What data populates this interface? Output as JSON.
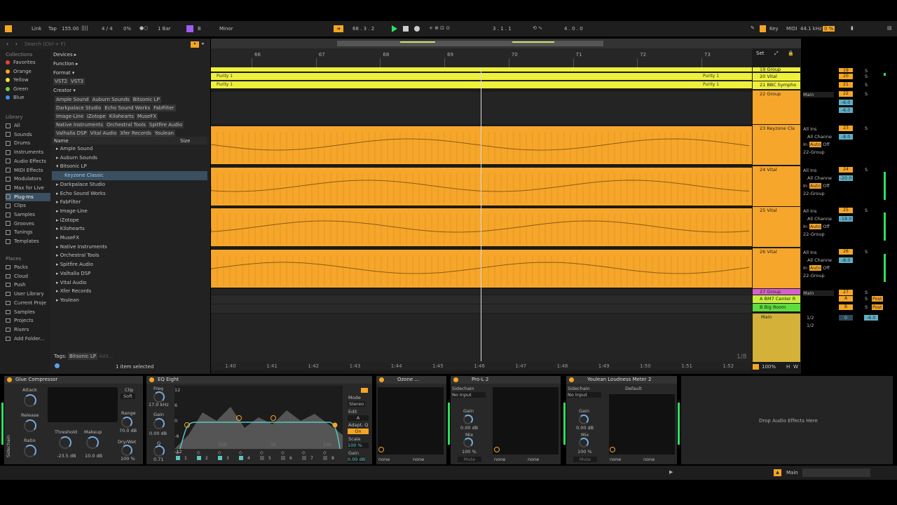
{
  "transport": {
    "link": "Link",
    "tap": "Tap",
    "tempo": "155.00",
    "signature": "4 / 4",
    "swing": "0%",
    "quantize": "1 Bar",
    "scale_root": "B",
    "scale_mode": "Minor",
    "position": "68 .  3 .  2",
    "loop_start": "3 .  1 .  1",
    "loop_length": "4 .  0 .  0",
    "key": "Key",
    "midi": "MIDI",
    "sample_rate": "44.1 kHz",
    "cpu": "0 %"
  },
  "browser": {
    "search_placeholder": "Search (Ctrl + F)",
    "collections_title": "Collections",
    "collections": [
      {
        "label": "Favorites",
        "color": "#e8433c"
      },
      {
        "label": "Orange",
        "color": "#f5a623"
      },
      {
        "label": "Yellow",
        "color": "#f0e040"
      },
      {
        "label": "Green",
        "color": "#6bd34a"
      },
      {
        "label": "Blue",
        "color": "#3d8ef0"
      }
    ],
    "library_title": "Library",
    "library": [
      "All",
      "Sounds",
      "Drums",
      "Instruments",
      "Audio Effects",
      "MIDI Effects",
      "Modulators",
      "Max for Live",
      "Plug-Ins",
      "Clips",
      "Samples",
      "Grooves",
      "Tunings",
      "Templates"
    ],
    "places_title": "Places",
    "places": [
      "Packs",
      "Cloud",
      "Push",
      "User Library",
      "Current Proje",
      "Samples",
      "Projects",
      "Risers",
      "Add Folder..."
    ],
    "filters": {
      "devices": "Devices ▸",
      "function": "Function ▸",
      "format": "Format ▾",
      "creator": "Creator ▾"
    },
    "format_tags": [
      "VST2",
      "VST3"
    ],
    "creator_tags": [
      "Ample Sound",
      "Auburn Sounds",
      "Bitsonic LP",
      "Darkpalace Studio",
      "Echo Sound Works",
      "FabFilter",
      "Image-Line",
      "iZotope",
      "Kilohearts",
      "MuseFX",
      "Native Instruments",
      "Orchestral Tools",
      "Spitfire Audio",
      "Valhalla DSP",
      "Vital Audio",
      "Xfer Records",
      "Youlean"
    ],
    "col_name": "Name",
    "col_size": "Size",
    "tree": [
      {
        "label": "▸ Ample Sound"
      },
      {
        "label": "▸ Auburn Sounds"
      },
      {
        "label": "▾ Bitsonic LP"
      },
      {
        "label": "Keyzone Classic",
        "selected": true
      },
      {
        "label": "▸ Darkpalace Studio"
      },
      {
        "label": "▸ Echo Sound Works"
      },
      {
        "label": "▸ FabFilter"
      },
      {
        "label": "▸ Image-Line"
      },
      {
        "label": "▸ iZotope"
      },
      {
        "label": "▸ Kilohearts"
      },
      {
        "label": "▸ MuseFX"
      },
      {
        "label": "▸ Native Instruments"
      },
      {
        "label": "▸ Orchestral Tools"
      },
      {
        "label": "▸ Spitfire Audio"
      },
      {
        "label": "▸ Valhalla DSP"
      },
      {
        "label": "▸ Vital Audio"
      },
      {
        "label": "▸ Xfer Records"
      },
      {
        "label": "▸ Youlean"
      }
    ],
    "tags_label": "Tags:",
    "tags_value": "Bitsonic LP",
    "tags_add": "Add...",
    "status": "1 item selected"
  },
  "arrangement": {
    "bars": [
      "66",
      "67",
      "68",
      "69",
      "70",
      "71",
      "72",
      "73"
    ],
    "times": [
      "1:40",
      "1:41",
      "1:42",
      "1:43",
      "1:44",
      "1:45",
      "1:46",
      "1:47",
      "1:48",
      "1:49",
      "1:50",
      "1:51",
      "1:52"
    ],
    "clip_name": "Purity 1",
    "grid": "1/8",
    "set_label": "Set",
    "zoom": "100%"
  },
  "tracks": [
    {
      "name": "19 Group",
      "num": "19"
    },
    {
      "name": "20 Vital",
      "num": "20"
    },
    {
      "name": "21 BBC Sympho",
      "num": "21"
    },
    {
      "name": "22 Group",
      "num": "22",
      "route": "Main",
      "vol": "-6.0",
      "pan": "-6.0"
    },
    {
      "name": "23 Keyzone Cla",
      "num": "23",
      "in": "All Ins",
      "ch": "All Channe",
      "vol": "-8.0",
      "group": "22-Group"
    },
    {
      "name": "24 Vital",
      "num": "24",
      "in": "All Ins",
      "ch": "All Channe",
      "vol": "-20.0",
      "group": "22-Group"
    },
    {
      "name": "25 Vital",
      "num": "25",
      "in": "All Ins",
      "ch": "All Channe",
      "vol": "-18.0",
      "group": "22-Group"
    },
    {
      "name": "26 Vital",
      "num": "26",
      "in": "All Ins",
      "ch": "All Channe",
      "vol": "-8.0",
      "group": "22-Group"
    },
    {
      "name": "27 Group",
      "num": "27",
      "route": "Main"
    }
  ],
  "returns": [
    {
      "name": "A BM7 Center R",
      "letter": "A",
      "post": "Post"
    },
    {
      "name": "B Big Room",
      "letter": "B",
      "post": "Post"
    }
  ],
  "master": {
    "name": "Main",
    "out1": "1/2",
    "out2": "1/2",
    "vol": "0",
    "pan": "-6.0"
  },
  "io": {
    "in": "In",
    "auto": "Auto",
    "off": "Off",
    "inf": "-∞",
    "s": "S",
    "c": "C"
  },
  "devices": {
    "glue": {
      "title": "Glue Compressor",
      "attack": "Attack",
      "release": "Release",
      "ratio": "Ratio",
      "clip": "Clip",
      "clip_val": "Soft",
      "threshold": "Threshold",
      "threshold_val": "-23.5 dB",
      "makeup": "Makeup",
      "makeup_val": "10.0 dB",
      "range": "Range",
      "range_val": "70.0 dB",
      "drywet": "Dry/Wet",
      "drywet_val": "100 %",
      "sidechain": "Sidechain"
    },
    "eq": {
      "title": "EQ Eight",
      "freq": "Freq",
      "freq_val": "17.0 kHz",
      "gain": "Gain",
      "gain_val": "0.00 dB",
      "q": "Q",
      "q_val": "0.71",
      "mode": "Mode",
      "mode_val": "Stereo",
      "edit": "Edit",
      "edit_val": "A",
      "adapt": "Adapt. Q",
      "adapt_val": "On",
      "scale": "Scale",
      "scale_val": "100 %",
      "out_gain": "Gain",
      "out_gain_val": "0.00 dB",
      "db_labels": [
        "12",
        "6",
        "0",
        "-6",
        "-12"
      ],
      "hz_labels": [
        "100",
        "1k",
        "10k"
      ],
      "bands": [
        "1",
        "2",
        "3",
        "4",
        "5",
        "6",
        "7",
        "8"
      ]
    },
    "ozone": {
      "title": "Ozone ...",
      "none1": "none",
      "none2": "none"
    },
    "pro": {
      "title": "Pro-L 2",
      "sidechain": "Sidechain",
      "input": "No Input",
      "gain": "Gain",
      "gain_val": "0.00 dB",
      "mix": "Mix",
      "mix_val": "100 %",
      "mute": "Mute",
      "none1": "none",
      "none2": "none"
    },
    "youlean": {
      "title": "Youlean Loudness Meter 2",
      "sidechain": "Sidechain",
      "input": "No Input",
      "gain": "Gain",
      "gain_val": "0.00 dB",
      "mix": "Mix",
      "mix_val": "100 %",
      "mute": "Mute",
      "preset": "Default",
      "none1": "none",
      "none2": "none"
    },
    "drop_hint": "Drop Audio Effects Here"
  },
  "statusbar": {
    "track": "Main"
  }
}
